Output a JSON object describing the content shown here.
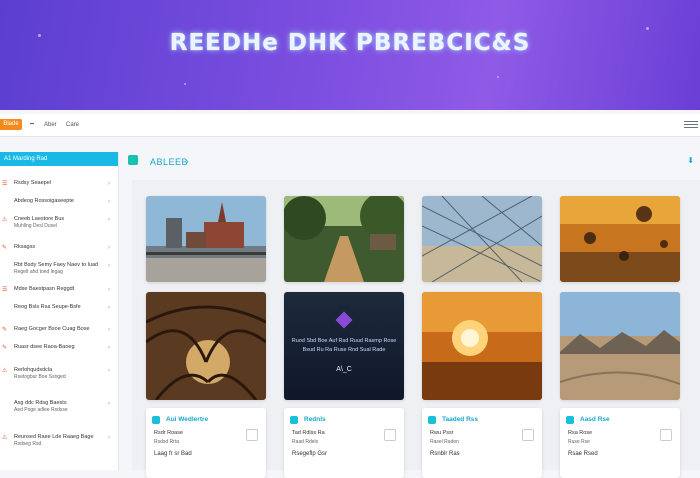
{
  "hero": {
    "title": "REEDHe DHK PBREBCIC&S"
  },
  "toolbar": {
    "button_label": "Blade",
    "links": [
      "Aber",
      "Care"
    ]
  },
  "sidebar": {
    "header": "A1 Marding Rad",
    "items": [
      {
        "t1": "Rsdsy Seaepel",
        "t2": "",
        "icon": "☰"
      },
      {
        "t1": "Abdeog Rossoigaseepte",
        "t2": "",
        "icon": ""
      },
      {
        "t1": "Cneeb Laestore Bus",
        "t2": "Muhllng Desl Dusel",
        "icon": "⚠"
      },
      {
        "t1": "Rksagss",
        "t2": "",
        "icon": "✎"
      },
      {
        "t1": "Rbt Bsdy Semy Faey Naev to luad",
        "t2": "Regelt ahd toed legag",
        "icon": ""
      },
      {
        "t1": "Mdse Baestpasn Reggdt",
        "t2": "",
        "icon": "☰"
      },
      {
        "t1": "Reog Bsls Rsa Seupe-Bsfe",
        "t2": "",
        "icon": ""
      },
      {
        "t1": "Raeg Gocger Bsoe Cuag Bose",
        "t2": "",
        "icon": "✎"
      },
      {
        "t1": "Ruasr dsee Raoa-Baoeg",
        "t2": "",
        "icon": "✎"
      },
      {
        "t1": "Rerlohqudsdcla",
        "t2": "Rsetogbur Boe Ssnged",
        "icon": "⚠"
      },
      {
        "t1": "Asg ddc Rdsg Baests",
        "t2": "Aed Poge adlee Rsdsse",
        "icon": ""
      },
      {
        "t1": "Reunsed Raee Lde Raaeg Bage",
        "t2": "Rsdseg Rsd",
        "icon": "⚠"
      }
    ]
  },
  "main": {
    "title": "ABLEEB",
    "right": "⬇"
  },
  "gallery": {
    "dark_caption": "Ruod Sbd Boe Auf Rsd Ruud Rasmp Rose",
    "dark_caption2": "Bsud Ru Ra Ruse Rnd Sual Rade",
    "dark_tag": "A\\_C"
  },
  "info_cards": [
    {
      "title": "Aui Wedlertre",
      "l1": "Rsdr Roase",
      "l2": "Rsdsd Rrta",
      "l3": "Laag fr sr Bad"
    },
    {
      "title": "Rednls",
      "l1": "Tad Rdlss Ra",
      "l2": "Raad Rdels",
      "l3": "Rsegeflp Gsr"
    },
    {
      "title": "Taaded Rss",
      "l1": "Rwu Pssr",
      "l2": "Rasel Raden",
      "l3": "Rsnblr Ras"
    },
    {
      "title": "Aasd Rse",
      "l1": "Rsa Rose",
      "l2": "Ruse Rse",
      "l3": "Rsae Rsed"
    }
  ]
}
